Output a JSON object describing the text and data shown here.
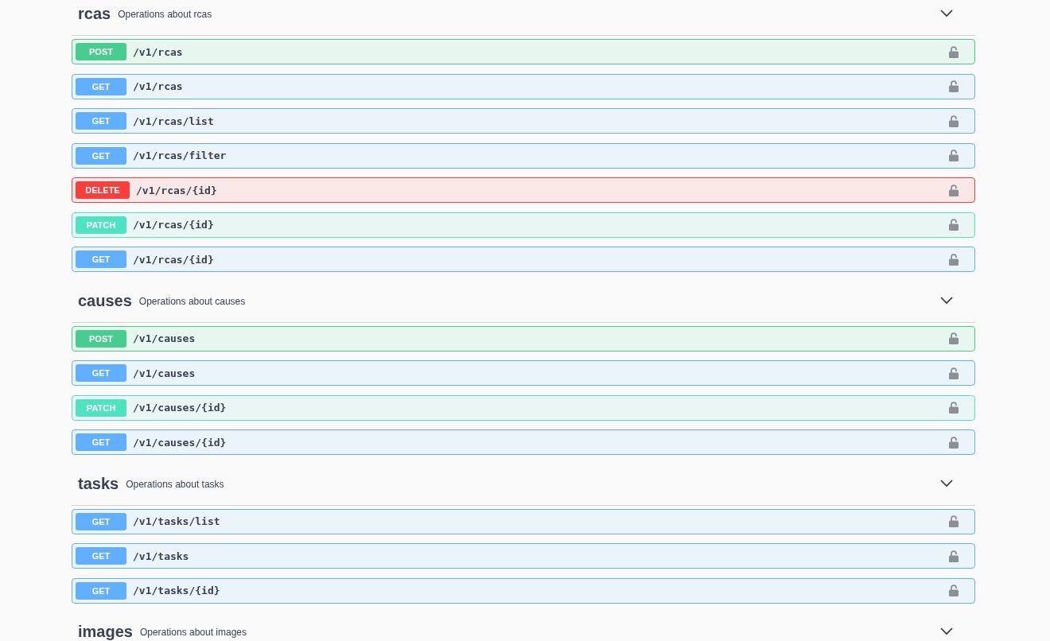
{
  "sections": [
    {
      "name": "rcas",
      "description": "Operations about rcas",
      "operations": [
        {
          "kind": "post",
          "method": "POST",
          "path": "/v1/rcas"
        },
        {
          "kind": "get",
          "method": "GET",
          "path": "/v1/rcas"
        },
        {
          "kind": "get",
          "method": "GET",
          "path": "/v1/rcas/list"
        },
        {
          "kind": "get",
          "method": "GET",
          "path": "/v1/rcas/filter"
        },
        {
          "kind": "delete",
          "method": "DELETE",
          "path": "/v1/rcas/{id}"
        },
        {
          "kind": "patch",
          "method": "PATCH",
          "path": "/v1/rcas/{id}"
        },
        {
          "kind": "get",
          "method": "GET",
          "path": "/v1/rcas/{id}"
        }
      ]
    },
    {
      "name": "causes",
      "description": "Operations about causes",
      "operations": [
        {
          "kind": "post",
          "method": "POST",
          "path": "/v1/causes"
        },
        {
          "kind": "get",
          "method": "GET",
          "path": "/v1/causes"
        },
        {
          "kind": "patch",
          "method": "PATCH",
          "path": "/v1/causes/{id}"
        },
        {
          "kind": "get",
          "method": "GET",
          "path": "/v1/causes/{id}"
        }
      ]
    },
    {
      "name": "tasks",
      "description": "Operations about tasks",
      "operations": [
        {
          "kind": "get",
          "method": "GET",
          "path": "/v1/tasks/list"
        },
        {
          "kind": "get",
          "method": "GET",
          "path": "/v1/tasks"
        },
        {
          "kind": "get",
          "method": "GET",
          "path": "/v1/tasks/{id}"
        }
      ]
    },
    {
      "name": "images",
      "description": "Operations about images"
    }
  ]
}
